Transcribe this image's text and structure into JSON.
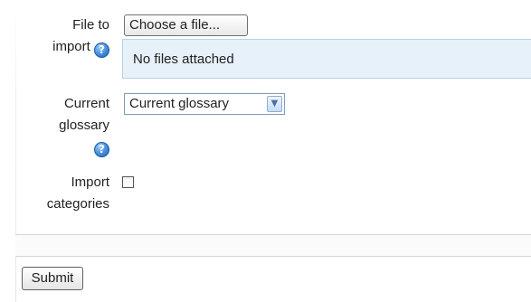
{
  "form": {
    "file_field": {
      "label_line1": "File to",
      "label_line2": "import",
      "button_label": "Choose a file...",
      "status_text": "No files attached"
    },
    "glossary_field": {
      "label_line1": "Current",
      "label_line2": "glossary",
      "selected_value": "Current glossary"
    },
    "categories_field": {
      "label_line1": "Import",
      "label_line2": "categories",
      "checked": false
    },
    "submit_label": "Submit",
    "help_icon_glyph": "?"
  },
  "colors": {
    "help_icon": "#4f96de",
    "filepicker_bg": "#e7f1fa",
    "filepicker_border": "#b9d3e6"
  },
  "icons": {
    "help": "help-icon",
    "dropdown": "chevron-down-icon"
  }
}
